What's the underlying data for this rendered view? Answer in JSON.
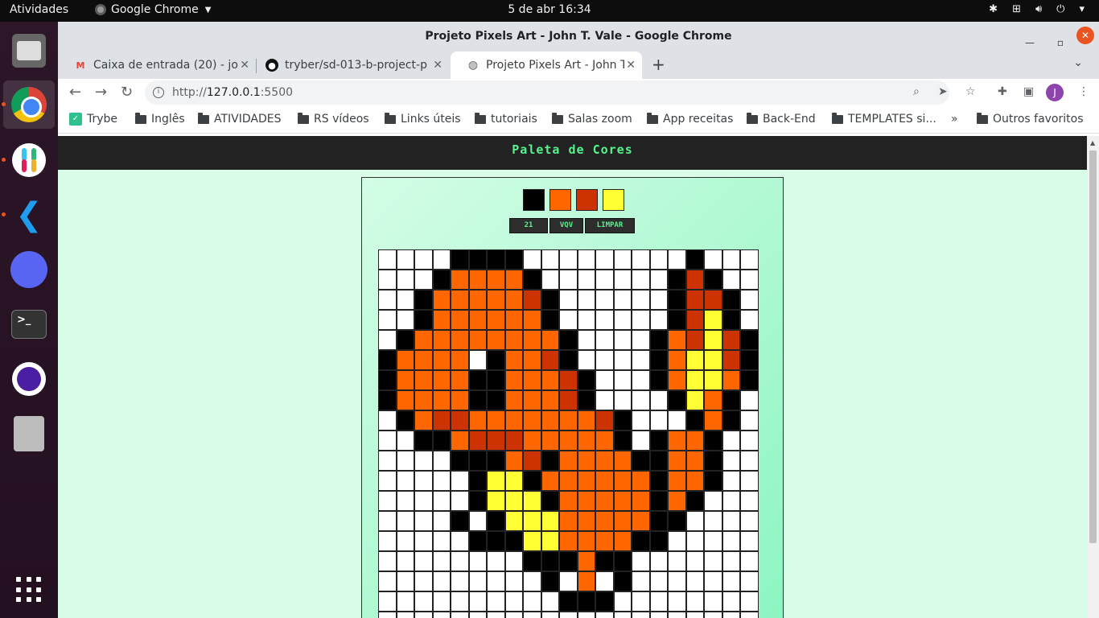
{
  "topbar": {
    "activities": "Atividades",
    "app_name": "Google Chrome",
    "clock": "5 de abr  16:34"
  },
  "window": {
    "title": "Projeto Pixels Art - John T. Vale - Google Chrome"
  },
  "tabs": [
    {
      "title": "Caixa de entrada (20) - joh",
      "icon": "gmail-icon"
    },
    {
      "title": "tryber/sd-013-b-project-pi",
      "icon": "github-icon"
    },
    {
      "title": "Projeto Pixels Art - John T",
      "icon": "globe-icon",
      "active": true
    }
  ],
  "address": {
    "scheme": "http://",
    "host": "127.0.0.1",
    "port": ":5500"
  },
  "profile_initial": "J",
  "bookmarks": {
    "items": [
      "Trybe",
      "Inglês",
      "ATIVIDADES",
      "RS vídeos",
      "Links úteis",
      "tutoriais",
      "Salas zoom",
      "App receitas",
      "Back-End",
      "TEMPLATES si..."
    ],
    "overflow": "»",
    "other": "Outros favoritos"
  },
  "page": {
    "header": "Paleta de Cores",
    "palette": [
      "#000000",
      "#ff6600",
      "#cc3300",
      "#ffff33"
    ],
    "controls": {
      "size_value": "21",
      "vqv": "VQV",
      "clear": "LIMPAR"
    },
    "grid_colors": {
      "W": "#ffffff",
      "K": "#000000",
      "O": "#ff6600",
      "R": "#cc3300",
      "Y": "#ffff33"
    },
    "grid_rows": [
      "WWWWKKKKWWWWWWWWWKWWW",
      "WWWKOOOOKWWWWWWWKRKWW",
      "WWKOOOOORKWWWWWWKRRKW",
      "WWKOOOOOOKWWWWWWKRYKW",
      "WKOOOOOOOOKWWWWKORYRK",
      "KOOOOWKOORKWWWWKOYYRK",
      "KOOOOKKOOORKWWWKOYYOK",
      "KOOOOKKOOORKWWWWKYOKW",
      "WKORROOOOOOORKWWWKOKWW",
      "WWKKORRROOOOOKWKOOKWW",
      "WWWWKKKORKOOOOKKOOKWW",
      "WWWWWKYYKOOOOOOKOOKWW",
      "WWWWWKYYYKOOOOOKOKWWW",
      "WWWWKWKYYYOOOOOKKWWWW",
      "WWWWWKKKYYOOOOKKWWWWW",
      "WWWWWWWWKKKOKKWWWWWWW",
      "WWWWWWWWWKWOWKWWWWWWW",
      "WWWWWWWWWWKKKWWWWWWWW",
      "WWWWWWWWWWWWWWWWWWWWW"
    ]
  }
}
